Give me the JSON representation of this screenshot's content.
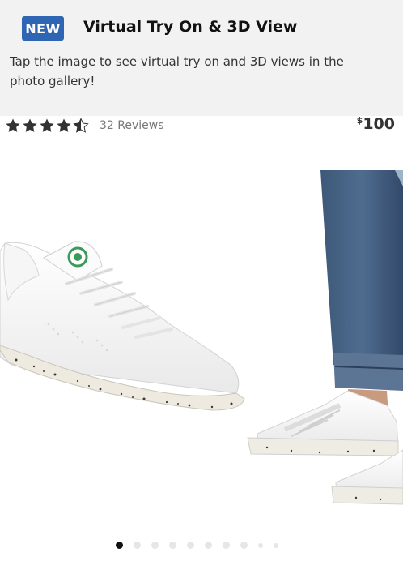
{
  "banner": {
    "badge": "NEW",
    "title": "Virtual Try On & 3D View",
    "text": "Tap the image to see virtual try on and 3D views in the photo gallery!"
  },
  "rating": {
    "stars": 4.5,
    "max_stars": 5,
    "review_count": "32 Reviews"
  },
  "price": {
    "currency": "$",
    "amount": "100"
  },
  "gallery": {
    "image_count": 10,
    "active_index": 0
  },
  "colors": {
    "badge_bg": "#2e66b3",
    "banner_bg": "#f2f2f2",
    "active_dot": "#111111",
    "inactive_dot": "#e6e6e6"
  }
}
